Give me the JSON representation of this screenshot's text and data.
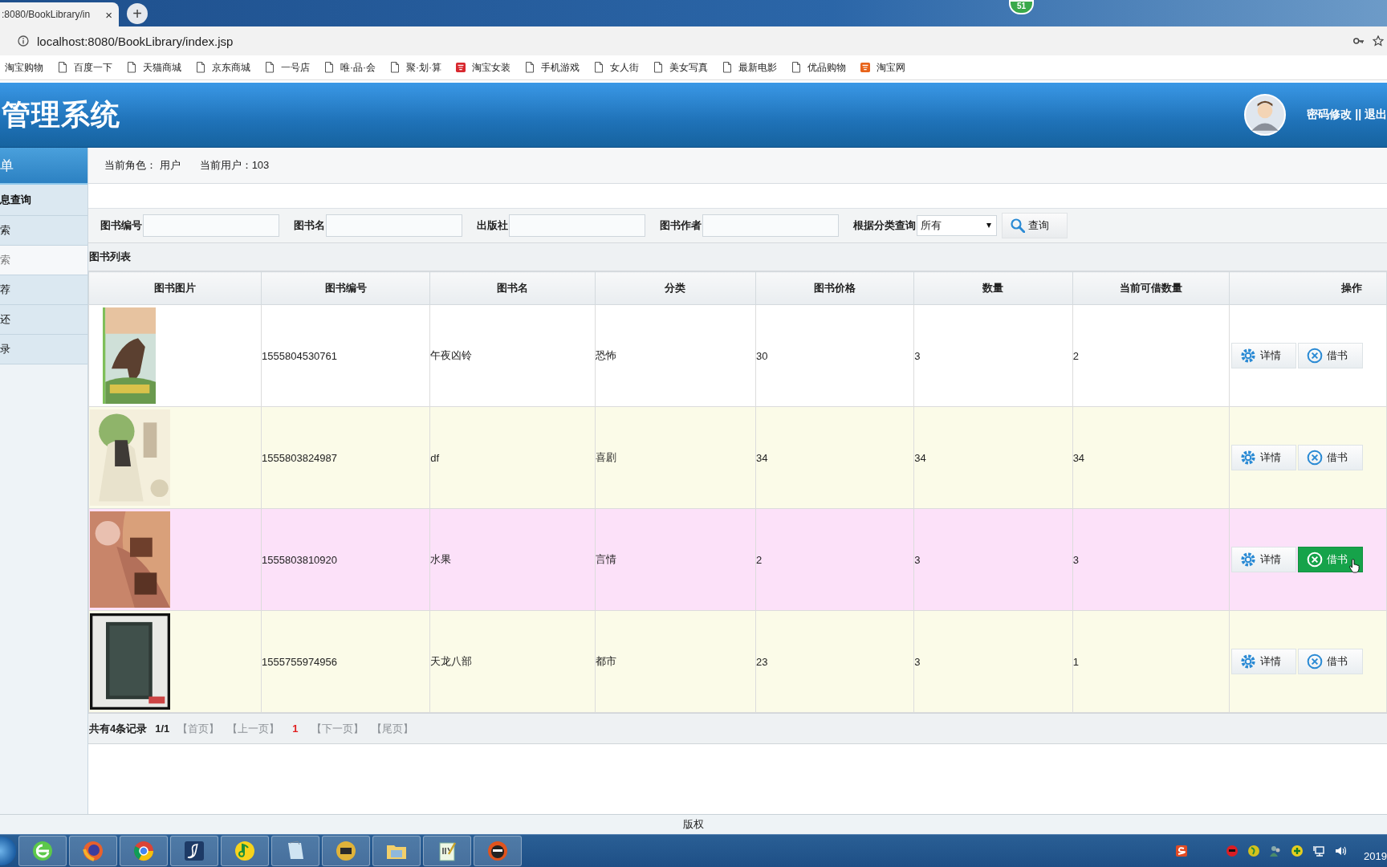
{
  "browser": {
    "tab_title": ":8080/BookLibrary/in",
    "tab_close": "×",
    "new_tab": "+",
    "badge": "51",
    "address": "localhost:8080/BookLibrary/index.jsp",
    "bookmarks": [
      {
        "label": "淘宝购物",
        "kind": "none"
      },
      {
        "label": "百度一下",
        "kind": "page"
      },
      {
        "label": "天猫商城",
        "kind": "page"
      },
      {
        "label": "京东商城",
        "kind": "page"
      },
      {
        "label": "一号店",
        "kind": "page"
      },
      {
        "label": "唯·品·会",
        "kind": "page"
      },
      {
        "label": "聚·划·算",
        "kind": "page"
      },
      {
        "label": "淘宝女装",
        "kind": "red"
      },
      {
        "label": "手机游戏",
        "kind": "page"
      },
      {
        "label": "女人街",
        "kind": "page"
      },
      {
        "label": "美女写真",
        "kind": "page"
      },
      {
        "label": "最新电影",
        "kind": "page"
      },
      {
        "label": "优品购物",
        "kind": "page"
      },
      {
        "label": "淘宝网",
        "kind": "orange"
      }
    ]
  },
  "header": {
    "title": "管理系统",
    "links": "密码修改 || 退出"
  },
  "sidebar": {
    "title": "单",
    "items": [
      {
        "label": "息查询",
        "selected": false
      },
      {
        "label": "索",
        "selected": false
      },
      {
        "label": "索",
        "selected": true
      },
      {
        "label": "荐",
        "selected": false
      },
      {
        "label": "还",
        "selected": false
      },
      {
        "label": "录",
        "selected": false
      }
    ]
  },
  "info": {
    "role": "当前角色： 用户",
    "user": "当前用户：103"
  },
  "filters": [
    {
      "label": "图书编号",
      "kind": "text"
    },
    {
      "label": "图书名",
      "kind": "text"
    },
    {
      "label": "出版社",
      "kind": "text"
    },
    {
      "label": "图书作者",
      "kind": "text"
    },
    {
      "label": "根据分类查询",
      "kind": "select",
      "value": "所有"
    }
  ],
  "search_button": "查询",
  "list_title": "图书列表",
  "table": {
    "columns": [
      "图书图片",
      "图书编号",
      "图书名",
      "分类",
      "图书价格",
      "数量",
      "当前可借数量",
      "操作"
    ],
    "rows": [
      {
        "number": "1555804530761",
        "name": "午夜凶铃",
        "category": "恐怖",
        "price": "30",
        "quantity": "3",
        "available": "2",
        "hovered": false,
        "detail_button": "详情",
        "borrow_button": "借书"
      },
      {
        "number": "1555803824987",
        "name": "df",
        "category": "喜剧",
        "price": "34",
        "quantity": "34",
        "available": "34",
        "hovered": false,
        "detail_button": "详情",
        "borrow_button": "借书"
      },
      {
        "number": "1555803810920",
        "name": "水果",
        "category": "言情",
        "price": "2",
        "quantity": "3",
        "available": "3",
        "hovered": true,
        "detail_button": "详情",
        "borrow_button": "借书"
      },
      {
        "number": "1555755974956",
        "name": "天龙八部",
        "category": "都市",
        "price": "23",
        "quantity": "3",
        "available": "1",
        "hovered": false,
        "detail_button": "详情",
        "borrow_button": "借书"
      }
    ]
  },
  "pagination": [
    {
      "text": "共有4条记录",
      "kind": "summary"
    },
    {
      "text": "1/1",
      "kind": "summary"
    },
    {
      "text": "【首页】",
      "kind": "link",
      "disabled": true
    },
    {
      "text": "【上一页】",
      "kind": "link",
      "disabled": true
    },
    {
      "text": "1",
      "kind": "current"
    },
    {
      "text": "【下一页】",
      "kind": "link",
      "disabled": true
    },
    {
      "text": "【尾页】",
      "kind": "link",
      "disabled": true
    }
  ],
  "footer": "版权",
  "taskbar": {
    "clock": "2019"
  }
}
